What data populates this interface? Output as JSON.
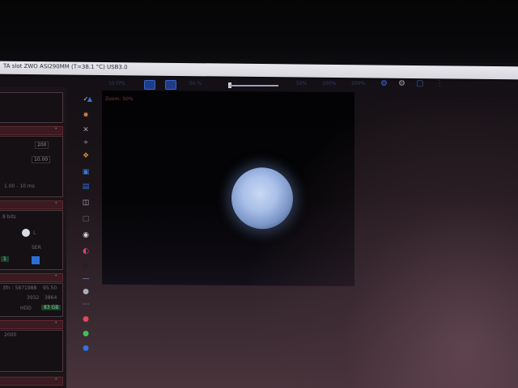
{
  "window": {
    "title": "TA slot   ZWO ASI290MM (T=38.1 °C) USB3.0"
  },
  "toolbar": {
    "fps": "10 FPS",
    "zoom_out_pct": "50 %",
    "pct_a": "50%",
    "pct_b": "100%",
    "pct_c": "200%"
  },
  "preview": {
    "zoom_label": "Zoom: 50%",
    "target": "planet"
  },
  "left_panel": {
    "value_1": "200",
    "value_2": "10.00",
    "range": "1.00 - 10 ms",
    "bits": "8 bits",
    "letter_l": "L",
    "ser": "SER",
    "bin_1": "1",
    "stats": "3fn : 5871988",
    "stat_a": "95.50",
    "stat_b": "3932",
    "stat_c": "3864",
    "hdd": "HDD",
    "free": "83 GB",
    "graph_label": "2000"
  },
  "icons": [
    "check-icon",
    "triangle-icon",
    "gear-icon",
    "cross-icon",
    "focus-icon",
    "star-icon",
    "folder-icon",
    "file-icon",
    "database-icon",
    "frame-icon",
    "record-icon",
    "palette-icon",
    "square-icon",
    "line-icon",
    "circle-gray-icon",
    "dots-icon",
    "red-ball-icon",
    "green-ball-icon",
    "blue-ball-icon"
  ],
  "colors": {
    "title_bar": "#e0dfe6",
    "toolbar_accent": "#2c5bc4",
    "panel_header": "#3b1a21",
    "planet": "#a9c0e8",
    "zoom_text": "#7a3b3b"
  }
}
